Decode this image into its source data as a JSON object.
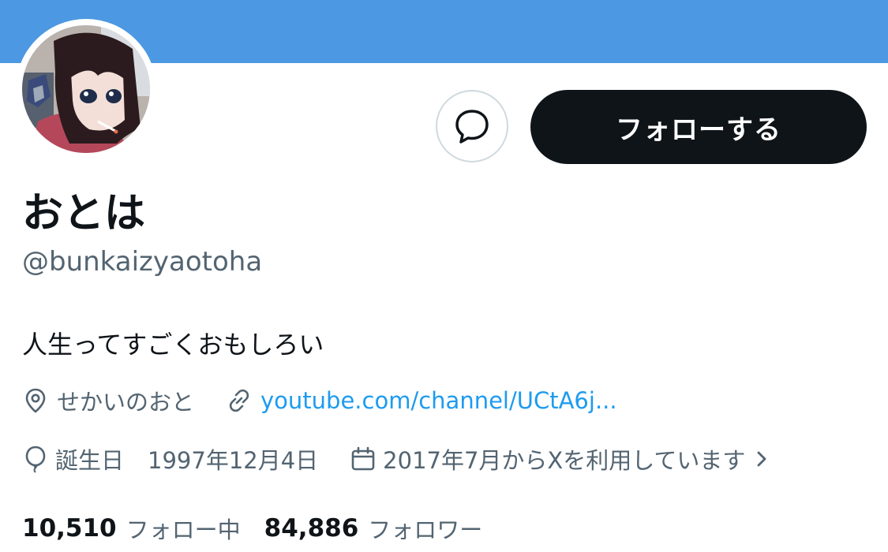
{
  "colors": {
    "banner": "#4c98e2",
    "primary_text": "#0f1419",
    "secondary_text": "#536471",
    "link": "#1d9bf0",
    "follow_button_bg": "#0f1419"
  },
  "header": {
    "avatar_icon": "profile-avatar",
    "message_icon": "message-bubble-icon",
    "follow_label": "フォローする"
  },
  "profile": {
    "display_name": "おとは",
    "handle": "@bunkaizyaotoha",
    "bio": "人生ってすごくおもしろい"
  },
  "meta": {
    "location_icon": "location-pin-icon",
    "location": "せかいのおと",
    "link_icon": "link-icon",
    "link": "youtube.com/channel/UCtA6j...",
    "birthday_icon": "balloon-icon",
    "birthday_label": "誕生日",
    "birthday_date": "1997年12月4日",
    "joined_icon": "calendar-icon",
    "joined": "2017年7月からXを利用しています",
    "chevron_icon": "chevron-right-icon"
  },
  "stats": {
    "following_count": "10,510",
    "following_label": "フォロー中",
    "followers_count": "84,886",
    "followers_label": "フォロワー"
  }
}
